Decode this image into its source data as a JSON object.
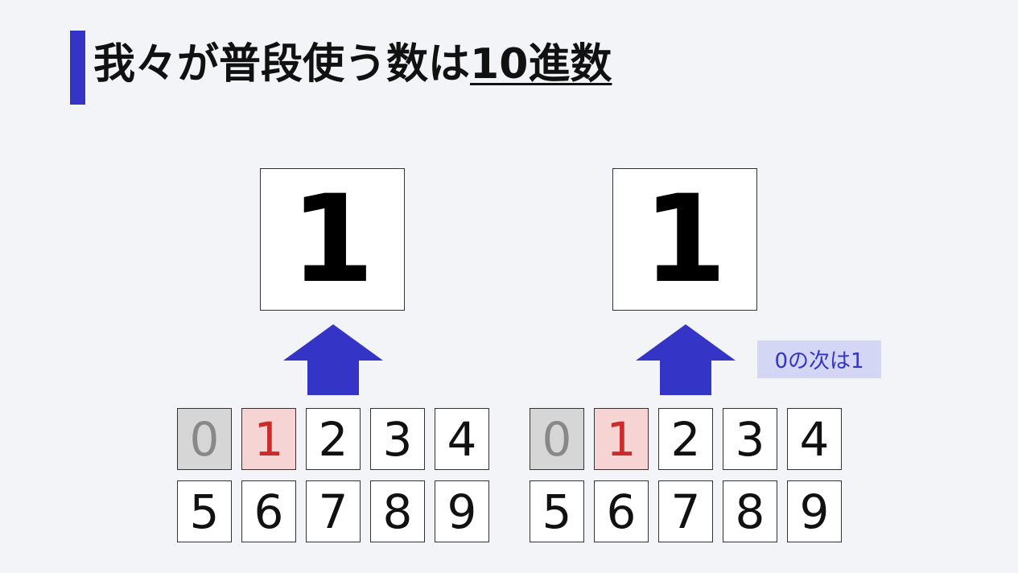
{
  "title": {
    "prefix": "我々が普段使う数は",
    "emphasis": "10進数"
  },
  "colors": {
    "accent": "#3434c6",
    "used_cell": "#d6d6d6",
    "current_cell": "#f6d4d4",
    "current_text": "#cc2b2b",
    "callout_bg": "#d4d6f6"
  },
  "panels": [
    {
      "display_value": "1",
      "digits": [
        "0",
        "1",
        "2",
        "3",
        "4",
        "5",
        "6",
        "7",
        "8",
        "9"
      ],
      "used_digit": "0",
      "current_digit": "1"
    },
    {
      "display_value": "1",
      "digits": [
        "0",
        "1",
        "2",
        "3",
        "4",
        "5",
        "6",
        "7",
        "8",
        "9"
      ],
      "used_digit": "0",
      "current_digit": "1",
      "callout": "0の次は1"
    }
  ]
}
